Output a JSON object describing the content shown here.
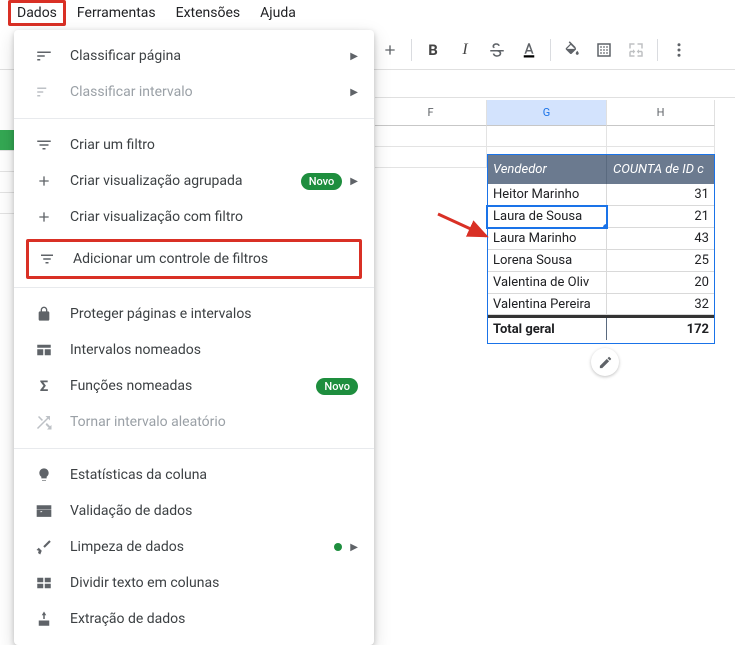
{
  "menubar": {
    "items": [
      "Dados",
      "Ferramentas",
      "Extensões",
      "Ajuda"
    ]
  },
  "toolbar": {
    "plus": "+",
    "bold": "B",
    "italic": "I"
  },
  "menu": {
    "sort_sheet": "Classificar página",
    "sort_range": "Classificar intervalo",
    "create_filter": "Criar um filtro",
    "create_grouped_view": "Criar visualização agrupada",
    "create_filter_view": "Criar visualização com filtro",
    "add_slicer": "Adicionar um controle de filtros",
    "protect": "Proteger páginas e intervalos",
    "named_ranges": "Intervalos nomeados",
    "named_functions": "Funções nomeadas",
    "randomize": "Tornar intervalo aleatório",
    "col_stats": "Estatísticas da coluna",
    "data_validation": "Validação de dados",
    "data_cleanup": "Limpeza de dados",
    "split_text": "Dividir texto em colunas",
    "data_extraction": "Extração de dados",
    "new_badge": "Novo"
  },
  "columns": {
    "F": "F",
    "G": "G",
    "H": "H"
  },
  "pivot": {
    "header1": "Vendedor",
    "header2": "COUNTA de ID c",
    "rows": [
      {
        "name": "Heitor Marinho",
        "val": "31"
      },
      {
        "name": "Laura de Sousa",
        "val": "21"
      },
      {
        "name": "Laura Marinho",
        "val": "43"
      },
      {
        "name": "Lorena Sousa",
        "val": "25"
      },
      {
        "name": "Valentina de Oliv",
        "val": "20"
      },
      {
        "name": "Valentina Pereira",
        "val": "32"
      }
    ],
    "total_label": "Total geral",
    "total_value": "172"
  }
}
